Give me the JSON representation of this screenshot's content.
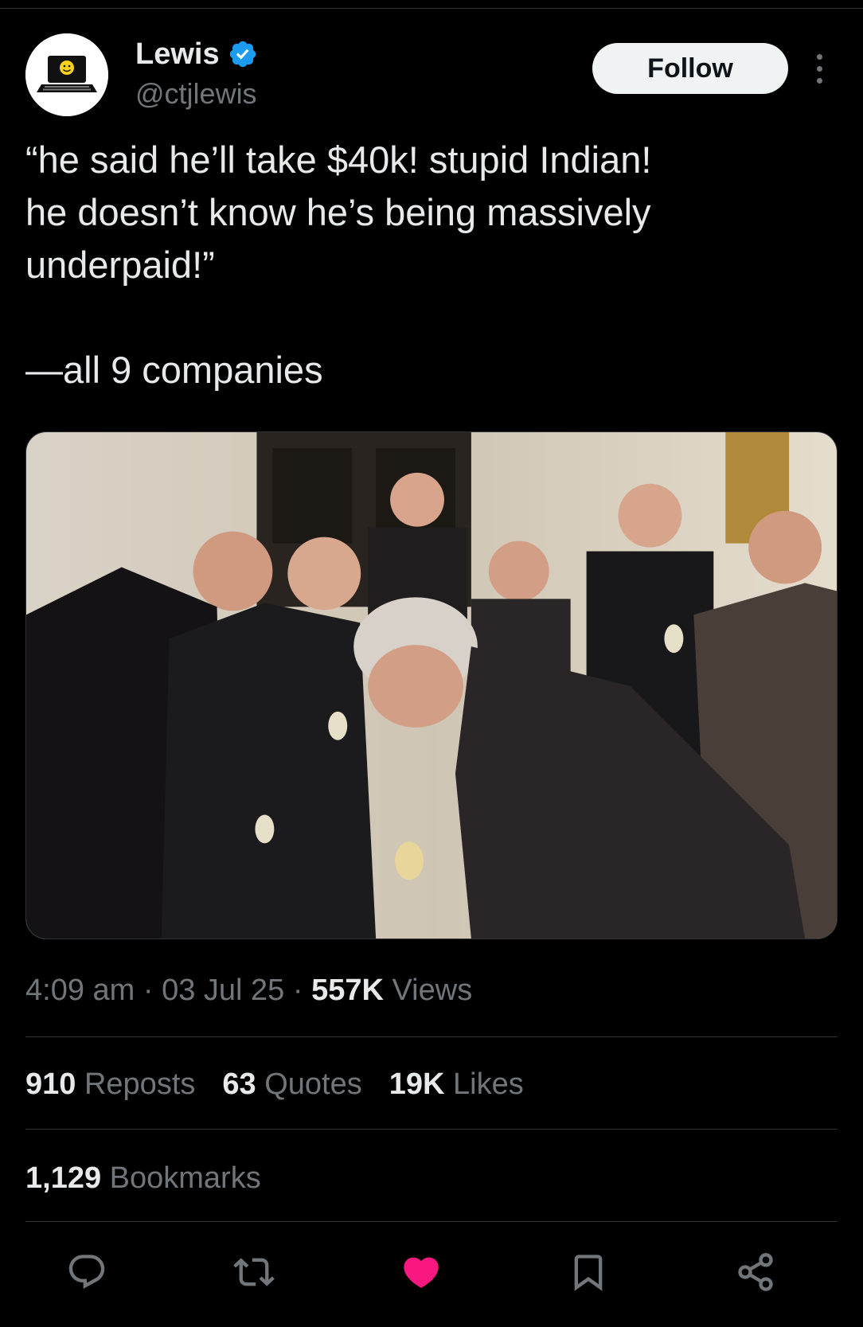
{
  "author": {
    "display_name": "Lewis",
    "handle": "@ctjlewis",
    "verified": true
  },
  "follow_button": {
    "label": "Follow"
  },
  "tweet": {
    "text": "“he said he’ll take $40k! stupid Indian!\nhe doesn’t know he’s being massively\nunderpaid!”\n\n—all 9 companies"
  },
  "media": {
    "description_icon": "photo"
  },
  "meta": {
    "time": "4:09 am",
    "date": "03 Jul 25",
    "separator": "·",
    "views_count": "557K",
    "views_label": "Views"
  },
  "stats": {
    "reposts_count": "910",
    "reposts_label": "Reposts",
    "quotes_count": "63",
    "quotes_label": "Quotes",
    "likes_count": "19K",
    "likes_label": "Likes",
    "bookmarks_count": "1,129",
    "bookmarks_label": "Bookmarks"
  },
  "actions": [
    {
      "icon": "reply-icon"
    },
    {
      "icon": "repost-icon"
    },
    {
      "icon": "like-icon",
      "active": true,
      "color": "#f91880"
    },
    {
      "icon": "bookmark-icon"
    },
    {
      "icon": "share-icon"
    }
  ],
  "colors": {
    "background": "#000000",
    "text_primary": "#e7e9ea",
    "text_secondary": "#71767b",
    "divider": "#2f3336",
    "verified": "#1d9bf0",
    "like_active": "#f91880"
  }
}
